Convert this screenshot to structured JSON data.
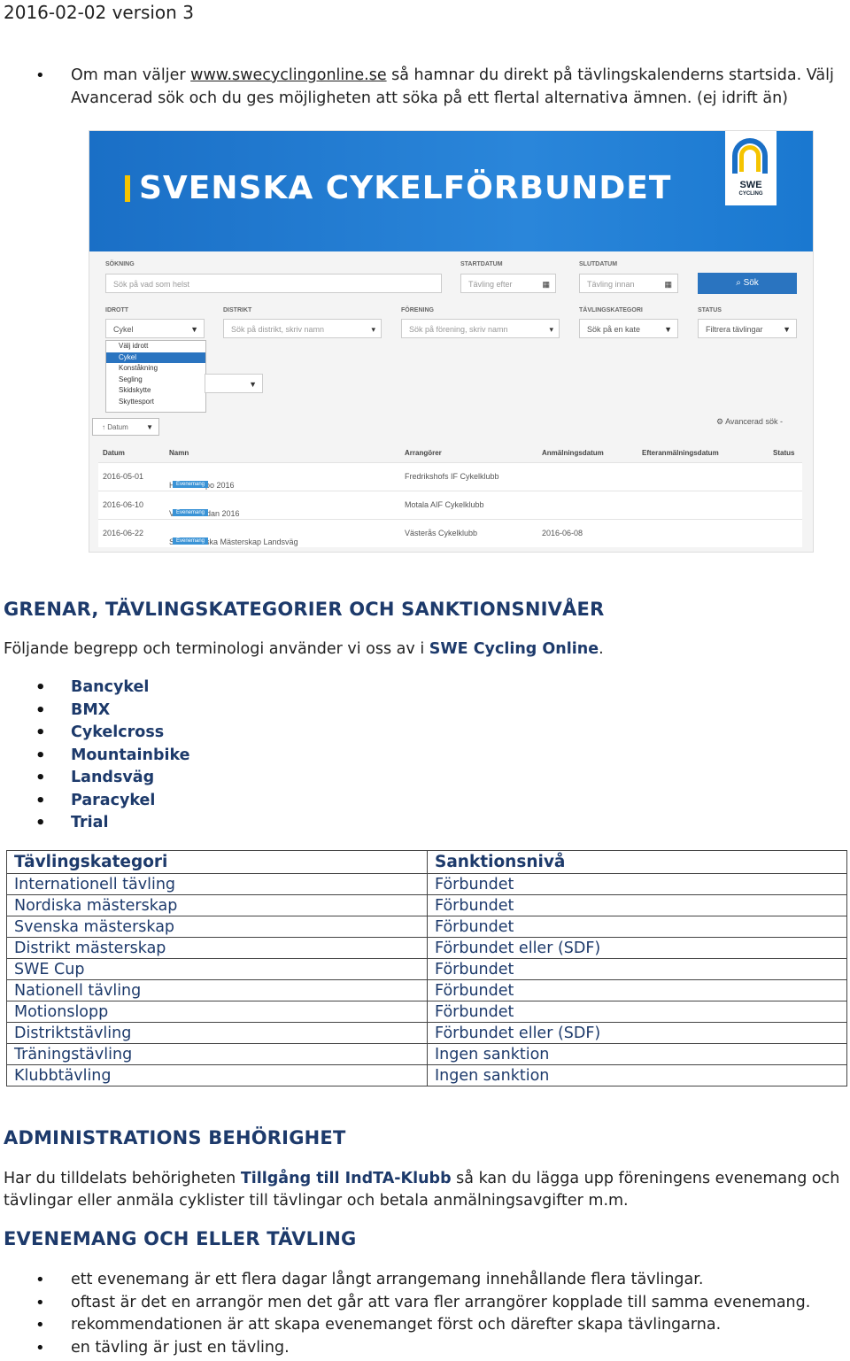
{
  "header": {
    "date_version": "2016-02-02 version 3"
  },
  "intro": {
    "prefix": "Om man väljer ",
    "link": "www.swecyclingonline.se",
    "rest_line1": " så hamnar du direkt på tävlingskalenderns startsida. Välj",
    "line2": "Avancerad sök och du ges möjligheten att söka på ett flertal alternativa ämnen. (ej idrift än)"
  },
  "screenshot": {
    "banner_title": "SVENSKA CYKELFÖRBUNDET",
    "logo_text": "SWE",
    "logo_sub": "CYCLING",
    "labels": {
      "sokning": "SÖKNING",
      "startdatum": "STARTDATUM",
      "slutdatum": "SLUTDATUM",
      "idrott": "IDROTT",
      "distrikt": "DISTRIKT",
      "forening": "FÖRENING",
      "tavlingskategori": "TÄVLINGSKATEGORI",
      "status": "STATUS"
    },
    "placeholders": {
      "search": "Sök på vad som helst",
      "start": "Tävling efter",
      "end": "Tävling innan",
      "idrott": "Cykel",
      "distrikt": "Sök på distrikt, skriv namn",
      "forening": "Sök på förening, skriv namn",
      "kategori": "Sök på en kate",
      "status": "Filtrera tävlingar"
    },
    "search_button": "Sök",
    "dropdown_options": [
      "Välj idrott",
      "Cykel",
      "Konståkning",
      "Segling",
      "Skidskytte",
      "Skyttesport"
    ],
    "dropdown_selected": "Cykel",
    "sort_label": "↑ Datum",
    "advanced_search": "Avancerad sök -",
    "columns": [
      "Datum",
      "Namn",
      "Arrangörer",
      "Anmälningsdatum",
      "Efteranmälningsdatum",
      "Status"
    ],
    "tag_label": "Evenemang",
    "rows": [
      {
        "date": "2016-05-01",
        "name": "Hofvettempo 2016",
        "arranger": "Fredrikshofs IF Cykelklubb",
        "anmalan": ""
      },
      {
        "date": "2016-06-10",
        "name": "Vätternrundan 2016",
        "arranger": "Motala AIF Cykelklubb",
        "anmalan": ""
      },
      {
        "date": "2016-06-22",
        "name": "SCF Svenska Mästerskap Landsväg",
        "arranger": "Västerås Cykelklubb",
        "anmalan": "2016-06-08"
      }
    ]
  },
  "section1": {
    "heading": "GRENAR, TÄVLINGSKATEGORIER OCH SANKTIONSNIVÅER",
    "para_prefix": "Följande begrepp och terminologi använder vi oss av i ",
    "para_bold": "SWE Cycling Online",
    "para_suffix": ".",
    "branches": [
      "Bancykel",
      "BMX",
      "Cykelcross",
      "Mountainbike",
      "Landsväg",
      "Paracykel",
      "Trial"
    ]
  },
  "table": {
    "headers": [
      "Tävlingskategori",
      "Sanktionsnivå"
    ],
    "rows": [
      [
        "Internationell tävling",
        "Förbundet"
      ],
      [
        "Nordiska mästerskap",
        "Förbundet"
      ],
      [
        "Svenska mästerskap",
        "Förbundet"
      ],
      [
        "Distrikt mästerskap",
        "Förbundet eller (SDF)"
      ],
      [
        "SWE Cup",
        "Förbundet"
      ],
      [
        "Nationell tävling",
        "Förbundet"
      ],
      [
        "Motionslopp",
        "Förbundet"
      ],
      [
        "Distriktstävling",
        "Förbundet eller (SDF)"
      ],
      [
        "Träningstävling",
        "Ingen sanktion"
      ],
      [
        "Klubbtävling",
        "Ingen sanktion"
      ]
    ]
  },
  "section2": {
    "heading": "ADMINISTRATIONS BEHÖRIGHET",
    "prefix": "Har du tilldelats behörigheten ",
    "bold": "Tillgång till IndTA-Klubb",
    "suffix": " så kan du lägga upp föreningens evenemang och",
    "line2": "tävlingar eller anmäla cyklister till tävlingar och betala anmälningsavgifter m.m."
  },
  "section3": {
    "heading": "EVENEMANG OCH ELLER TÄVLING",
    "bullets": [
      "ett evenemang är ett flera dagar långt arrangemang innehållande flera tävlingar.",
      "oftast är det en arrangör men det går att vara fler arrangörer kopplade till samma evenemang.",
      "rekommendationen är att skapa evenemanget först och därefter skapa tävlingarna.",
      "en tävling är just en tävling."
    ]
  }
}
